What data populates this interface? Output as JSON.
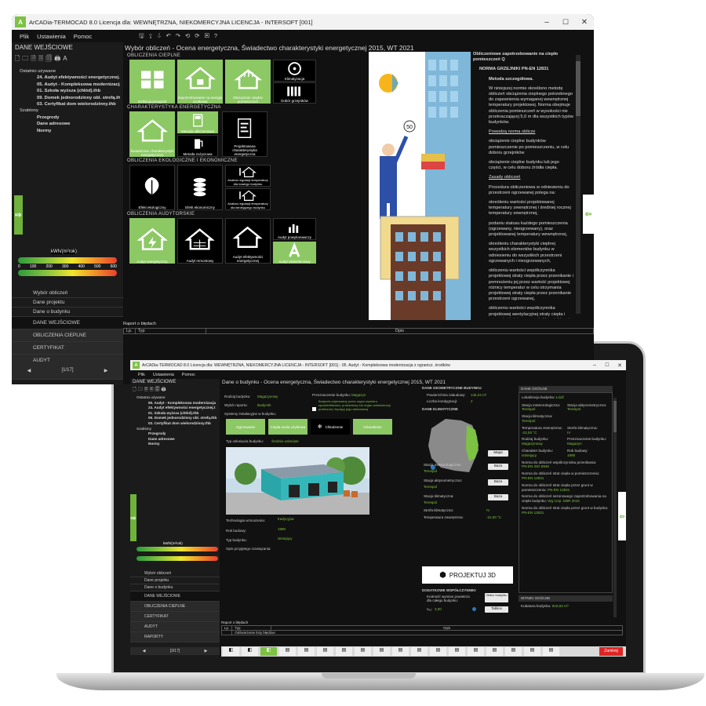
{
  "back": {
    "title": "ArCADia-TERMOCAD 8.0 Licencja dla: WEWNĘTRZNA, NIEKOMERCYJNA LICENCJA - INTERSOFT [001]",
    "menu": [
      "Plik",
      "Ustawienia",
      "Pomoc"
    ],
    "page_title": "Wybór obliczeń - Ocena energetyczna, Świadectwo charakterystyki energetycznej 2015, WT 2021",
    "side_header": "DANE WEJŚCIOWE",
    "tree": [
      "Ostatnio używane",
      "24. Audyt efektywności energetycznej.t",
      "05. Audyt - Kompleksowa modernizacja",
      "01. Szkoła wyższa (chłód).thb",
      "09. Domek jednorodzinny obl. strefą.thl",
      "03. Certyfikat dom wielorodzinny.thb",
      "Szablony",
      "Przegrody",
      "Dane adresowe",
      "Normy"
    ],
    "scale_unit": "kWh/(m²rok)",
    "scale_ticks": [
      "0",
      "100",
      "200",
      "300",
      "400",
      "500",
      "600"
    ],
    "nav_items": [
      "Wybór obliczeń",
      "Dane projektu",
      "Dane o budynku"
    ],
    "nav_cats": [
      "DANE WEJŚCIOWE",
      "OBLICZENIA CIEPLNE",
      "CERTYFIKAT",
      "AUDYT",
      "RAPORTY"
    ],
    "pager": "[1/17]",
    "sections": [
      "OBLICZENIA CIEPLNE",
      "CHARAKTERYSTYKA ENERGETYCZNA",
      "OBLICZENIA EKOLOGICZNE I EKONOMICZNE",
      "OBLICZENIA AUDYTORSKIE"
    ],
    "tiles": {
      "t1": "Definicja przegród",
      "t2": "Zapotrzebowanie na energię użytkową",
      "t3": "Obciążenie cieplne pomieszczeń",
      "t4": "Klimatyzacja",
      "t5": "Dobór grzejników",
      "t6": "Świadectwo charakterystyki energetycznej",
      "t7": "Metoda obliczeniowa",
      "t8": "Metoda zużyciowa",
      "t9": "Projektowana charakterystyka energetyczna",
      "t10": "Efekt ekologiczny",
      "t11": "Efekt ekonomiczny",
      "t12": "Analiza regulacji temperatury dla nowego budynku",
      "t13": "Analiza regulacji temperatury dla istniejącego budynku",
      "t14": "Audyt energetyczny",
      "t15": "Audyt remontowy",
      "t16": "Audyt efektywności energetycznej",
      "t17": "Audyt powykonawczy",
      "t18": "Audyt oświetleniowy"
    },
    "speech": "50",
    "right_title": "Obliczeniowe zapotrzebowanie na ciepło pomieszczeń Q",
    "right_norm": "NORMA GRZEJNIKI PN-EN 12831",
    "right_method": "Metoda szczegółowa.",
    "right_p1": "W niniejszej normie określono metodę obliczeń obciążenia cieplnego potrzebnego do zapewnienia wymaganej wewnętrznej temperatury projektowej. Norma obejmuje obliczenia pomieszczeń w wysokości nie przekraczającej 5,0 m dla wszystkich typów budynków.",
    "right_link1": "Powodzą norma oblicze",
    "right_b1": "obciążenie cieplne budynków pomieszczenie po pomieszczeniu, w celu doboru grzejników",
    "right_b2": "obciążenie cieplne budynku lub jego części, w celu doboru źródła ciepła.",
    "right_link2": "Zasady obliczeń",
    "right_p2": "Procedura obliczeniowa w odniesieniu do przestrzeni ogrzewanej polega na:",
    "right_b3": "określeniu wartości projektowanej temperatury zewnętrznej i średniej rocznej temperatury zewnętrznej,",
    "right_b4": "podaniu statusu każdego pomieszczenia (ogrzewany, nieogrzewany), oraz projektowanej temperatury wewnętrznej,",
    "right_b5": "określeniu charakterystyki cieplnej wszystkich elementów budynku w odniesieniu do wszystkich przestrzeni ogrzewanych i nieogrzewanych,",
    "right_b6": "obliczeniu wartości współczynnika projektowej straty ciepła przez przenikanie i pomnożeniu jej przez wartość projektowej różnicy temperatur w celu otrzymania projektowej straty ciepła przez przenikanie przestrzeni ogrzewanej,",
    "right_b7": "obliczeniu wartości współczynnika projektowej wentylacyjnej straty ciepła i pomnożeniu jej przez wartość projektowej różnicy temperatur w celu otrzymania",
    "err_title": "Raport o błędach",
    "err_cols": [
      "Lp.",
      "Typ",
      "Opis"
    ]
  },
  "front": {
    "title": "ArCADia-TERMOCAD 8.0 Licencja dla: WEWNĘTRZNA, NIEKOMERCYJNA LICENCJA - INTERSOFT [001] - 05. Audyt - Kompleksowa modernizacja z ogranicz. środków",
    "menu": [
      "Plik",
      "Ustawienia",
      "Pomoc"
    ],
    "page_title": "Dane o budynku - Ocena energetyczna, Świadectwo charakterystyki energetycznej 2015, WT 2021",
    "side_header": "DANE WEJŚCIOWE",
    "tree": [
      "Ostatnio używane",
      "05. Audyt - Kompleksowa modernizacja",
      "24. Audyt efektywności energetycznej.t",
      "01. Szkoła wyższa (chłód).thb",
      "09. Domek jednorodzinny obl. strefą.thb",
      "03. Certyfikat dom wielorodzinny.thb",
      "Szablony",
      "Przegrody",
      "Dane adresowe",
      "Normy"
    ],
    "scale_unit": "kWh/(m²rok)",
    "nav_items": [
      "Wybór obliczeń",
      "Dane projektu",
      "Dane o budynku"
    ],
    "nav_cats": [
      "DANE WEJŚCIOWE",
      "OBLICZENIA CIEPLNE",
      "CERTYFIKAT",
      "AUDYT",
      "RAPORTY"
    ],
    "pager": "[3/17]",
    "form": {
      "rodzaj_l": "Rodzaj budynku:",
      "rodzaj_v": "Magazynowy",
      "wybor_l": "Wybór raportu:",
      "wybor_v": "Budynek",
      "przezn_l": "Przeznaczenie budynku:",
      "przezn_v": "Magazyn",
      "check_txt": "Budynek zajmowany przez organ wymiaru sprawiedliwości, prokuraturę lub organ administracji publicznej i będący jego własnością",
      "systemy_l": "Systemy instalacyjne w budynku:",
      "sys": [
        "Ogrzewanie",
        "Ciepła woda użytkowa",
        "Chłodzenie",
        "Oświetlenie"
      ],
      "typ_osl_l": "Typ osłonięcia budynku:",
      "typ_osl_v": "Średnio osłonięte",
      "tech_l": "Technologia wznoszenia:",
      "tech_v": "tradycyjna",
      "rok_l": "Rok budowy:",
      "rok_v": "1990",
      "typbud_l": "Typ budynku:",
      "typbud_v": "istniejący",
      "opis_l": "Opis przyjętego rozwiązania:"
    },
    "geo": {
      "head": "DANE GEOMETRYCZNE BUDYNKU",
      "pow_l": "Powierzchnia zabudowy:",
      "pow_v": "146,24 m²",
      "kond_l": "Liczba kondygnacji:",
      "kond_v": "2",
      "klim_head": "DANE KLIMATYCZNE",
      "mapa": "Mapa",
      "baza1": "Baza",
      "baza2": "Baza",
      "baza3": "Baza",
      "met_l": "Stacja meteorologiczna:",
      "met_v": "Terespol",
      "akt_l": "Stacja aktynometryczna:",
      "akt_v": "Terespol",
      "klim_l": "Stacja klimatyczna:",
      "klim_v": "Terespol",
      "strefa_l": "Strefa klimatyczna:",
      "strefa_v": "IV",
      "temp_l": "Temperatura zewnętrzna:",
      "temp_v": "-22,00 °C",
      "proj3d": "PROJEKTUJ 3D",
      "dod_head": "DODATKOWE WSPÓŁCZYNNIKI",
      "krot_l": "Krotność wymian powietrza dla całego budynku:",
      "n50_l": "n₅₀:",
      "n50_v": "3,00",
      "oblicz": "Oblicz budynku",
      "tablice": "Tablice"
    },
    "info": {
      "head": "DANE OGÓLNE",
      "lok_l": "Lokalizacja budynku:",
      "lok_v": "Łódź",
      "sm_l": "Stacja meteorologiczna:",
      "sm_v": "Terespol",
      "sa_l": "Stacja aktynometryczna:",
      "sa_v": "Terespol",
      "sk_l": "Stacja klimatyczna:",
      "sk_v": "Terespol",
      "tz_l": "Temperatura zewnętrzna:",
      "tz_v": "-22,00 °C",
      "sz_l": "Strefa klimatyczna:",
      "sz_v": "IV",
      "rb_l": "Rodzaj budynku:",
      "rb_v": "Magazynowy",
      "pb_l": "Przeznaczenie budynku:",
      "pb_v": "Magazyn",
      "cb_l": "Charakter budynku:",
      "cb_v": "Istniejący",
      "ry_l": "Rok budowy:",
      "ry_v": "1990",
      "n1_l": "Norma do obliczeń współczynnika przenikania:",
      "n1_v": "PN-EN ISO 6946",
      "n2_l": "Norma do obliczeń strat ciepła w pomieszczeniu:",
      "n2_v": "PN-EN 12831",
      "n3_l": "Norma do obliczeń strat ciepła przez grunt w pomieszczeniu:",
      "n3_v": "PN-EN 12831",
      "n4_l": "Norma do obliczeń sezonowego zapotrzebowania na ciepło budynku:",
      "n4_v": "Wg rozp. MIiR 2015",
      "n5_l": "Norma do obliczeń strat ciepła przez grunt w budynku:",
      "n5_v": "PN-EN 12831",
      "wyn_head": "WYNIKI OGÓLNE",
      "kub_l": "Kubatura budynku:",
      "kub_v": "818,92 m³"
    },
    "err_title": "Raport o błędach",
    "err_cols": [
      "Lp.",
      "Typ",
      "Opis"
    ],
    "err_row": "Odświeżenie listy błędów!",
    "zamknij": "Zamknij"
  },
  "colors": {
    "accent": "#7dc242",
    "dark": "#111111"
  }
}
